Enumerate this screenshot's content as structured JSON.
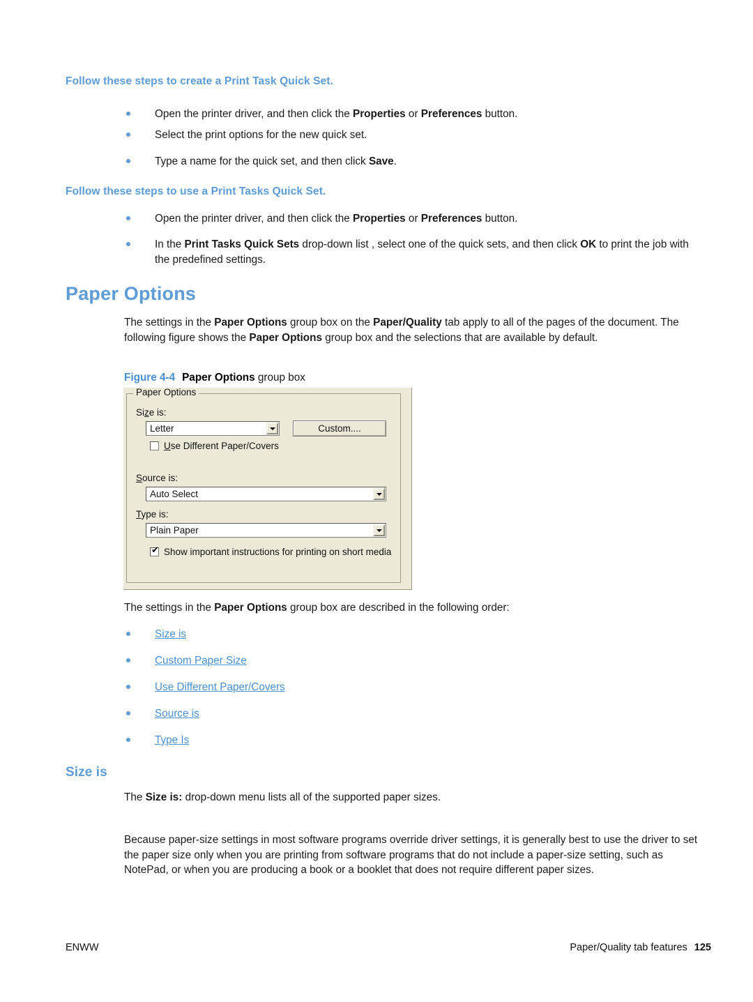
{
  "document": {
    "sections": {
      "quickset_create_heading": "Follow these steps to create a Print Task Quick Set.",
      "quickset_use_heading": "Follow these steps to use a Print Tasks Quick Set.",
      "paper_options_heading": "Paper Options",
      "size_is_heading": "Size is"
    },
    "bullets_create": [
      {
        "parts": [
          {
            "t": "Open the printer driver, and then click the ",
            "b": false
          },
          {
            "t": "Properties",
            "b": true
          },
          {
            "t": " or ",
            "b": false
          },
          {
            "t": "Preferences",
            "b": true
          },
          {
            "t": " button.",
            "b": false
          }
        ]
      },
      {
        "parts": [
          {
            "t": "Select the print options for the new quick set.",
            "b": false
          }
        ]
      },
      {
        "parts": [
          {
            "t": "Type a name for the quick set, and then click ",
            "b": false
          },
          {
            "t": "Save",
            "b": true
          },
          {
            "t": ".",
            "b": false
          }
        ]
      }
    ],
    "bullets_use": [
      {
        "parts": [
          {
            "t": "Open the printer driver, and then click the ",
            "b": false
          },
          {
            "t": "Properties",
            "b": true
          },
          {
            "t": " or ",
            "b": false
          },
          {
            "t": "Preferences",
            "b": true
          },
          {
            "t": " button.",
            "b": false
          }
        ]
      },
      {
        "parts": [
          {
            "t": "In the ",
            "b": false
          },
          {
            "t": "Print Tasks Quick Sets",
            "b": true
          },
          {
            "t": " drop-down list , select one of the quick sets, and then click ",
            "b": false
          },
          {
            "t": "OK",
            "b": true
          },
          {
            "t": " to print the job with the predefined settings.",
            "b": false
          }
        ]
      }
    ],
    "paragraph_paper_options": {
      "parts": [
        {
          "t": "The settings in the ",
          "b": false
        },
        {
          "t": "Paper Options",
          "b": true
        },
        {
          "t": " group box on the ",
          "b": false
        },
        {
          "t": "Paper/Quality",
          "b": true
        },
        {
          "t": " tab apply to all of the pages of the document. The following figure shows the ",
          "b": false
        },
        {
          "t": "Paper Options",
          "b": true
        },
        {
          "t": " group box and the selections that are available by default.",
          "b": false
        }
      ]
    },
    "figure_caption": {
      "number": "Figure 4-4",
      "bold_title": "Paper Options",
      "rest": " group box"
    },
    "paragraph_described_order": {
      "parts": [
        {
          "t": "The settings in the ",
          "b": false
        },
        {
          "t": "Paper Options",
          "b": true
        },
        {
          "t": " group box are described in the following order:",
          "b": false
        }
      ]
    },
    "link_bullets": [
      "Size is",
      "Custom Paper Size",
      "Use Different Paper/Covers",
      "Source is",
      "Type Is"
    ],
    "paragraph_size_is_1": {
      "parts": [
        {
          "t": "The ",
          "b": false
        },
        {
          "t": "Size is:",
          "b": true
        },
        {
          "t": " drop-down menu lists all of the supported paper sizes.",
          "b": false
        }
      ]
    },
    "paragraph_size_is_2": {
      "parts": [
        {
          "t": "Because paper-size settings in most software programs override driver settings, it is generally best to use the driver to set the paper size only when you are printing from software programs that do not include a paper-size setting, such as NotePad, or when you are producing a book or a booklet that does not require different paper sizes.",
          "b": false
        }
      ]
    },
    "footer": {
      "left": "ENWW",
      "right_label": "Paper/Quality tab features",
      "page_number": "125"
    }
  },
  "figure_dialog": {
    "group_box_legend": "Paper Options",
    "size_is_label": "Size is:",
    "size_is_value": "Letter",
    "custom_button_label": "Custom....",
    "use_different_checkbox": {
      "label": "Use Different Paper/Covers",
      "checked": false
    },
    "source_is_label": "Source is:",
    "source_is_value": "Auto Select",
    "type_is_label": "Type is:",
    "type_is_value": "Plain Paper",
    "show_instructions_checkbox": {
      "label": "Show important instructions for printing on short media",
      "checked": true,
      "tick_glyph": "✔"
    },
    "dropdown_arrow_glyph": "▼"
  },
  "colors": {
    "heading_blue": "#5D9CD6",
    "link_blue": "#4A8FD0",
    "body_text": "#1a1a1a",
    "dialog_face": "#ece9d8",
    "dialog_border": "#9d9b87"
  }
}
